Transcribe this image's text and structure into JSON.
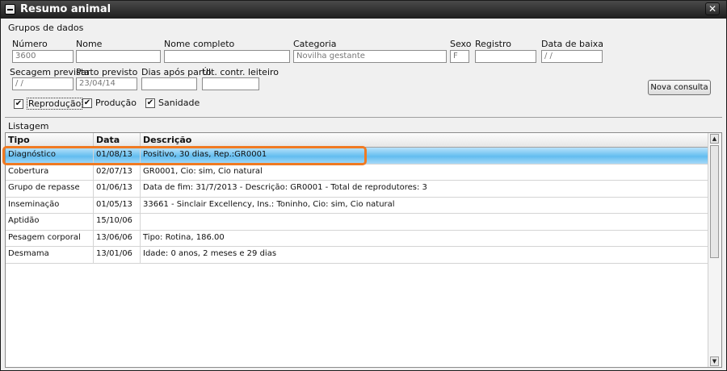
{
  "window": {
    "title": "Resumo animal",
    "close_glyph": "✕"
  },
  "group": {
    "title": "Grupos de dados",
    "numero_label": "Número",
    "numero_value": "3600",
    "nome_label": "Nome",
    "nome_value": "",
    "nome_completo_label": "Nome completo",
    "nome_completo_value": "",
    "categoria_label": "Categoria",
    "categoria_value": "Novilha gestante",
    "sexo_label": "Sexo",
    "sexo_value": "F",
    "registro_label": "Registro",
    "registro_value": "",
    "data_baixa_label": "Data de baixa",
    "data_baixa_value": " / /",
    "secagem_label": "Secagem prevista",
    "secagem_value": " / /",
    "parto_label": "Parto previsto",
    "parto_value": "23/04/14",
    "dias_label": "Dias após parto",
    "dias_value": "",
    "ult_label": "Últ. contr. leiteiro",
    "ult_value": "",
    "check_reproducao": "Reprodução",
    "check_producao": "Produção",
    "check_sanidade": "Sanidade",
    "check_mark": "✔",
    "nova_consulta": "Nova consulta"
  },
  "list": {
    "title": "Listagem",
    "headers": {
      "tipo": "Tipo",
      "data": "Data",
      "descricao": "Descrição"
    },
    "rows": [
      {
        "tipo": "Diagnóstico",
        "data": "01/08/13",
        "descricao": "Positivo, 30 dias, Rep.:GR0001"
      },
      {
        "tipo": "Cobertura",
        "data": "02/07/13",
        "descricao": "GR0001, Cio: sim, Cio natural"
      },
      {
        "tipo": "Grupo de repasse",
        "data": "01/06/13",
        "descricao": "Data de fim: 31/7/2013 - Descrição: GR0001 - Total de reprodutores: 3"
      },
      {
        "tipo": "Inseminação",
        "data": "01/05/13",
        "descricao": "33661 - Sinclair Excellency, Ins.: Toninho, Cio: sim, Cio natural"
      },
      {
        "tipo": "Aptidão",
        "data": "15/10/06",
        "descricao": ""
      },
      {
        "tipo": "Pesagem corporal",
        "data": "13/06/06",
        "descricao": "Tipo: Rotina, 186.00"
      },
      {
        "tipo": "Desmama",
        "data": "13/01/06",
        "descricao": "Idade: 0 anos, 2 meses e 29 dias"
      }
    ],
    "scroll_up": "▲",
    "scroll_down": "▼"
  }
}
